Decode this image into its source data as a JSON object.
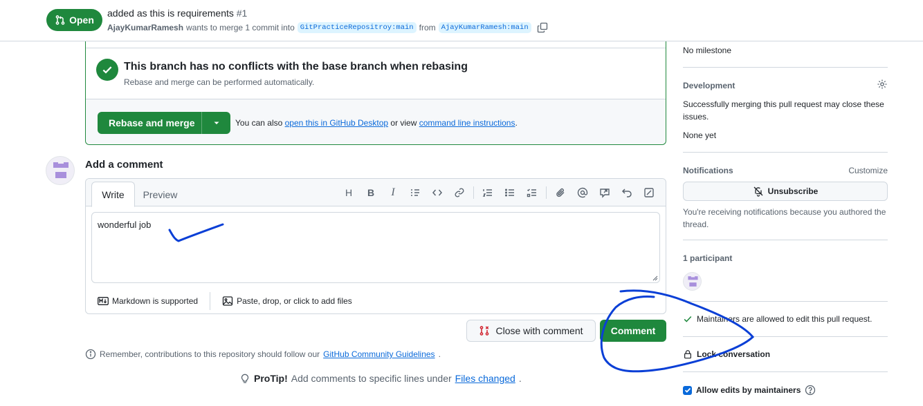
{
  "header": {
    "state_label": "Open",
    "title": "added as this is requirements",
    "number": "#1",
    "author": "AjayKumarRamesh",
    "merge_text": "wants to merge 1 commit into",
    "base_branch": "GitPracticeRepositroy:main",
    "from_text": "from",
    "head_branch": "AjayKumarRamesh:main"
  },
  "merge_box": {
    "heading": "This branch has no conflicts with the base branch when rebasing",
    "subtext": "Rebase and merge can be performed automatically.",
    "button_label": "Rebase and merge",
    "alt_prefix": "You can also",
    "alt_link_desktop": "open this in GitHub Desktop",
    "alt_middle": "or view",
    "alt_link_cli": "command line instructions",
    "alt_suffix": "."
  },
  "composer": {
    "title": "Add a comment",
    "tabs": {
      "write": "Write",
      "preview": "Preview"
    },
    "toolbar_icons": [
      "heading-icon",
      "bold-icon",
      "italic-icon",
      "quote-icon",
      "code-icon",
      "link-icon",
      "numbered-list-icon",
      "unordered-list-icon",
      "task-list-icon",
      "attach-icon",
      "mention-icon",
      "cross-reference-icon",
      "undo-icon",
      "fullscreen-icon"
    ],
    "toolbar_heading_glyph": "H",
    "toolbar_bold_glyph": "B",
    "toolbar_italic_glyph": "I",
    "text_value": "wonderful job",
    "markdown_note": "Markdown is supported",
    "attach_note": "Paste, drop, or click to add files"
  },
  "actions": {
    "close_with_comment": "Close with comment",
    "comment": "Comment"
  },
  "guidelines": {
    "prefix": "Remember, contributions to this repository should follow our",
    "link": "GitHub Community Guidelines",
    "suffix": "."
  },
  "protip": {
    "label": "ProTip!",
    "text": "Add comments to specific lines under",
    "link": "Files changed",
    "suffix": "."
  },
  "sidebar": {
    "milestone": "No milestone",
    "development": {
      "heading": "Development",
      "text": "Successfully merging this pull request may close these issues.",
      "none": "None yet"
    },
    "notifications": {
      "heading": "Notifications",
      "customize": "Customize",
      "button": "Unsubscribe",
      "reason": "You're receiving notifications because you authored the thread."
    },
    "participants": {
      "heading": "1 participant"
    },
    "maintainers_note": "Maintainers are allowed to edit this pull request.",
    "lock": "Lock conversation",
    "allow_edits": "Allow edits by maintainers"
  },
  "colors": {
    "green": "#1f883d",
    "link": "#0969da",
    "annotation": "#0a3fd6"
  }
}
